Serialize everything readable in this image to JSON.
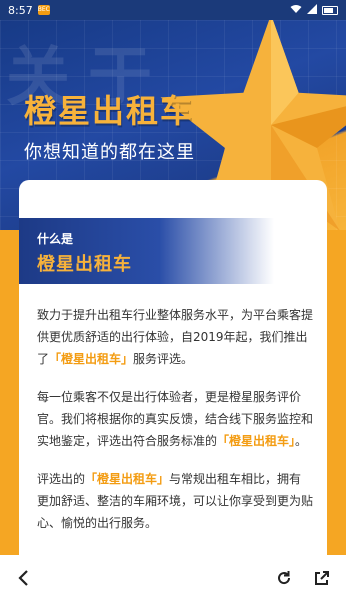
{
  "status_bar": {
    "time": "8:57",
    "app_badge": "BEC"
  },
  "hero": {
    "bg_text": "关于",
    "title": "橙星出租车",
    "subtitle": "你想知道的都在这里"
  },
  "card": {
    "banner_small": "什么是",
    "banner_big": "橙星出租车",
    "paragraphs": [
      {
        "pre": "致力于提升出租车行业整体服务水平，为平台乘客提供更优质舒适的出行体验，自2019年起，我们推出了",
        "hl": "「橙星出租车」",
        "post": "服务评选。"
      },
      {
        "pre": "每一位乘客不仅是出行体验者，更是橙星服务评价官。我们将根据你的真实反馈，结合线下服务监控和实地鉴定，评选出符合服务标准的",
        "hl": "「橙星出租车」",
        "post": "。"
      },
      {
        "pre": "评选出的",
        "hl": "「橙星出租车」",
        "post": "与常规出租车相比，拥有更加舒适、整洁的车厢环境，可以让你享受到更为贴心、愉悦的出行服务。"
      }
    ]
  },
  "toolbar": {
    "back_icon": "chevron-left-icon",
    "refresh_icon": "refresh-icon",
    "share_icon": "share-icon"
  },
  "colors": {
    "brand_blue": "#1d3a86",
    "brand_orange": "#f7b23b",
    "highlight": "#f39c12"
  }
}
